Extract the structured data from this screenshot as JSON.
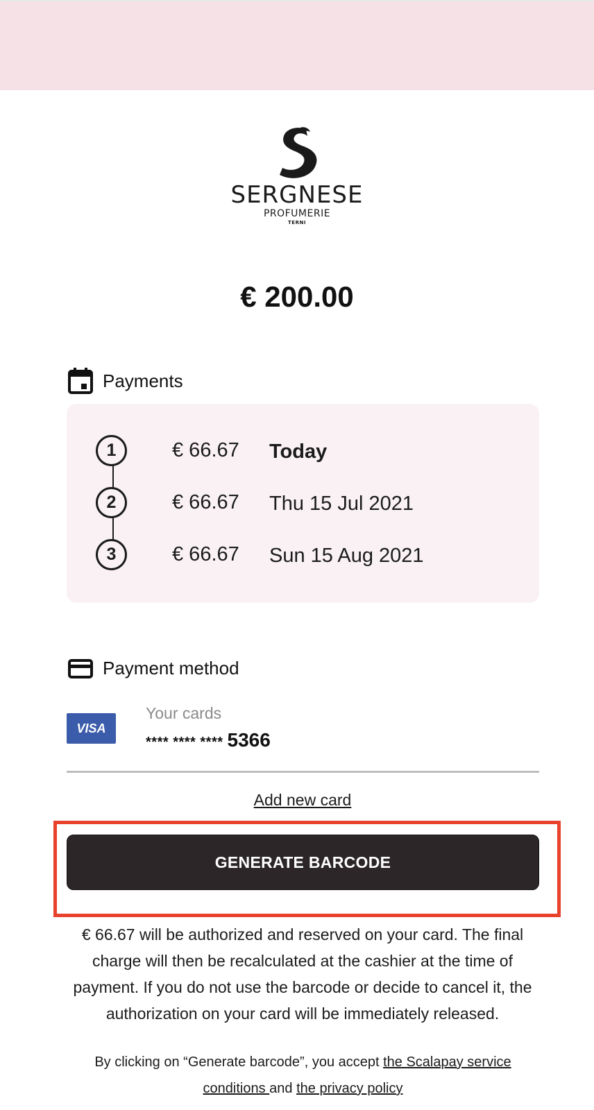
{
  "merchant": {
    "name": "SERGNESE",
    "subtitle": "PROFUMERIE",
    "city": "TERNI"
  },
  "order": {
    "total": "€ 200.00"
  },
  "payments": {
    "title": "Payments",
    "installments": [
      {
        "number": "1",
        "amount": "€ 66.67",
        "date": "Today"
      },
      {
        "number": "2",
        "amount": "€ 66.67",
        "date": "Thu 15 Jul 2021"
      },
      {
        "number": "3",
        "amount": "€ 66.67",
        "date": "Sun 15 Aug 2021"
      }
    ]
  },
  "payment_method": {
    "title": "Payment method",
    "card_brand": "VISA",
    "label": "Your cards",
    "masked_prefix": "**** **** ****",
    "last4": "5366",
    "add_new_card": "Add new card"
  },
  "actions": {
    "generate_barcode": "GENERATE BARCODE"
  },
  "info": {
    "authorization_text": "€ 66.67 will be authorized and reserved on your card. The final charge will then be recalculated at the cashier at the time of payment. If you do not use the barcode or decide to cancel it, the authorization on your card will be immediately released.",
    "legal_prefix": "By clicking on “Generate barcode”, you accept ",
    "service_conditions_link": "the Scalapay service conditions ",
    "legal_and": "and ",
    "privacy_link": "the privacy policy"
  },
  "colors": {
    "header_band": "#f6e1e6",
    "installments_bg": "#f9f1f3",
    "button_bg": "#2c2628",
    "highlight_border": "#e8412c",
    "visa_blue": "#3b5bab"
  }
}
